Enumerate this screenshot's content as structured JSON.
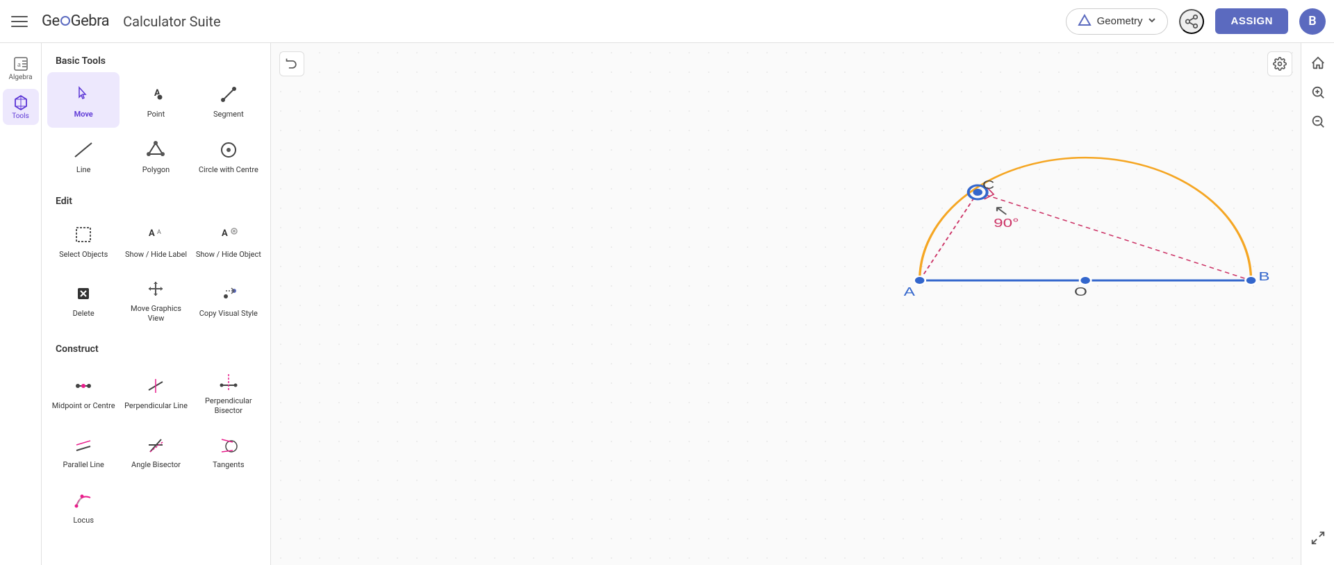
{
  "header": {
    "menu_label": "Menu",
    "logo": "GeoGebra",
    "app_name": "Calculator Suite",
    "geometry_btn": "Geometry",
    "share_label": "Share",
    "assign_label": "ASSIGN",
    "user_initial": "B"
  },
  "sidebar": {
    "items": [
      {
        "id": "algebra",
        "label": "Algebra",
        "icon": "algebra"
      },
      {
        "id": "tools",
        "label": "Tools",
        "icon": "tools",
        "active": true
      }
    ]
  },
  "tools_panel": {
    "sections": [
      {
        "id": "basic-tools",
        "title": "Basic Tools",
        "tools": [
          {
            "id": "move",
            "label": "Move",
            "active": true
          },
          {
            "id": "point",
            "label": "Point",
            "active": false
          },
          {
            "id": "segment",
            "label": "Segment",
            "active": false
          },
          {
            "id": "line",
            "label": "Line",
            "active": false
          },
          {
            "id": "polygon",
            "label": "Polygon",
            "active": false
          },
          {
            "id": "circle-with-centre",
            "label": "Circle with Centre",
            "active": false
          }
        ]
      },
      {
        "id": "edit",
        "title": "Edit",
        "tools": [
          {
            "id": "select-objects",
            "label": "Select Objects",
            "active": false
          },
          {
            "id": "show-hide-label",
            "label": "Show / Hide Label",
            "active": false
          },
          {
            "id": "show-hide-object",
            "label": "Show / Hide Object",
            "active": false
          },
          {
            "id": "delete",
            "label": "Delete",
            "active": false
          },
          {
            "id": "move-graphics-view",
            "label": "Move Graphics View",
            "active": false
          },
          {
            "id": "copy-visual-style",
            "label": "Copy Visual Style",
            "active": false
          }
        ]
      },
      {
        "id": "construct",
        "title": "Construct",
        "tools": [
          {
            "id": "midpoint-or-centre",
            "label": "Midpoint or Centre",
            "active": false
          },
          {
            "id": "perpendicular-line",
            "label": "Perpendicular Line",
            "active": false
          },
          {
            "id": "perpendicular-bisector",
            "label": "Perpendicular Bisector",
            "active": false
          },
          {
            "id": "parallel-line",
            "label": "Parallel Line",
            "active": false
          },
          {
            "id": "angle-bisector",
            "label": "Angle Bisector",
            "active": false
          },
          {
            "id": "tangents",
            "label": "Tangents",
            "active": false
          },
          {
            "id": "locus",
            "label": "Locus",
            "active": false
          }
        ]
      }
    ]
  },
  "canvas": {
    "undo_label": "Undo",
    "settings_label": "Settings",
    "home_label": "Home",
    "zoom_in_label": "Zoom in",
    "zoom_out_label": "Zoom out",
    "fullscreen_label": "Fullscreen",
    "geometry": {
      "point_a_label": "A",
      "point_b_label": "B",
      "point_o_label": "O",
      "point_c_label": "C",
      "angle_label": "90°",
      "accent_color": "#f5a623",
      "line_color": "#3366cc",
      "angle_line_color": "#cc3366"
    }
  }
}
